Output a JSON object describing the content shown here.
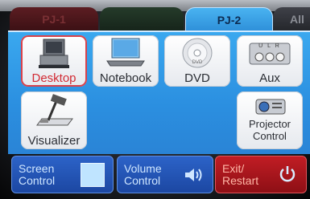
{
  "tabs": [
    {
      "label": "PJ-1"
    },
    {
      "label": ""
    },
    {
      "label": "PJ-2"
    },
    {
      "label": "All"
    }
  ],
  "devices": {
    "desktop": "Desktop",
    "notebook": "Notebook",
    "dvd": "DVD",
    "aux": "Aux",
    "aux_ports": "U  L  R",
    "visualizer": "Visualizer",
    "projector": "Projector Control"
  },
  "controls": {
    "screen_line1": "Screen",
    "screen_line2": "Control",
    "volume_line1": "Volume",
    "volume_line2": "Control",
    "exit_line1": "Exit/",
    "exit_line2": "Restart"
  },
  "colors": {
    "active_tab": "#3aa8ef",
    "selected": "#d22a33",
    "exit": "#c11d24"
  }
}
